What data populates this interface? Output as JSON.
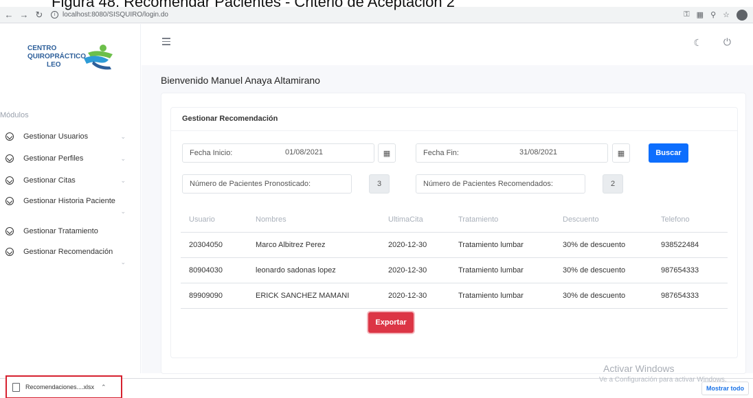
{
  "caption": "Figura 48. Recomendar Pacientes - Criterio de Aceptación 2",
  "browser": {
    "url": "localhost:8080/SISQUIRO/login.do"
  },
  "logo": {
    "line1": "CENTRO",
    "line2": "QUIROPRÁCTICO",
    "line3": "LEO"
  },
  "sidebar": {
    "title": "Módulos",
    "items": [
      {
        "label": "Gestionar Usuarios"
      },
      {
        "label": "Gestionar Perfiles"
      },
      {
        "label": "Gestionar Citas"
      },
      {
        "label": "Gestionar Historia Paciente"
      },
      {
        "label": "Gestionar Tratamiento"
      },
      {
        "label": "Gestionar Recomendación"
      }
    ]
  },
  "header": {
    "welcome": "Bienvenido Manuel Anaya Altamirano"
  },
  "card": {
    "title": "Gestionar Recomendación",
    "fecha_inicio_label": "Fecha Inicio:",
    "fecha_inicio_value": "01/08/2021",
    "fecha_fin_label": "Fecha Fin:",
    "fecha_fin_value": "31/08/2021",
    "search_button": "Buscar",
    "pronosticado_label": "Número de Pacientes Pronosticado:",
    "pronosticado_value": "3",
    "recomendados_label": "Número de Pacientes Recomendados:",
    "recomendados_value": "2",
    "export_button": "Exportar"
  },
  "table": {
    "headers": [
      "Usuario",
      "Nombres",
      "UltimaCita",
      "Tratamiento",
      "Descuento",
      "Telefono"
    ],
    "rows": [
      [
        "20304050",
        "Marco Albitrez Perez",
        "2020-12-30",
        "Tratamiento lumbar",
        "30% de descuento",
        "938522484"
      ],
      [
        "80904030",
        "leonardo sadonas lopez",
        "2020-12-30",
        "Tratamiento lumbar",
        "30% de descuento",
        "987654333"
      ],
      [
        "89909090",
        "ERICK SANCHEZ MAMANI",
        "2020-12-30",
        "Tratamiento lumbar",
        "30% de descuento",
        "987654333"
      ]
    ]
  },
  "watermark": {
    "line1": "Activar Windows",
    "line2": "Ve a Configuración para activar Windows."
  },
  "downloads": {
    "file": "Recomendaciones....xlsx",
    "show_all": "Mostrar todo"
  },
  "colors": {
    "primary": "#0d6efd",
    "danger": "#dc3545",
    "highlight": "#d6202e",
    "logo_blue": "#2d5f9a",
    "logo_green": "#6cbf4a"
  }
}
